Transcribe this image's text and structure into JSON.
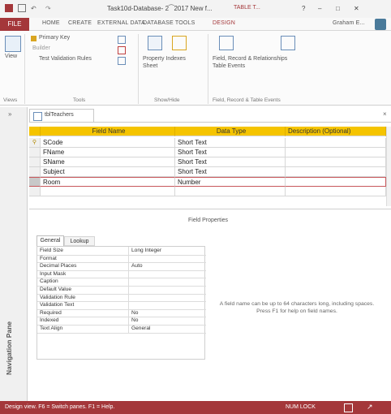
{
  "window": {
    "title": "Task10d‐Database‐ 2⁀2017 New f...",
    "context_tab": "TABLE T...",
    "help": "?",
    "user": "Graham E..."
  },
  "ribbon_tabs": [
    "FILE",
    "HOME",
    "CREATE",
    "EXTERNAL DATA",
    "DATABASE TOOLS",
    "DESIGN"
  ],
  "ribbon": {
    "view_label": "View",
    "primary_key": "Primary Key",
    "builder": "Builder",
    "test_validation": "Test Validation Rules",
    "property_sheet": "Property Indexes\nSheet",
    "field_record_events": "Field, Record & Relationships\nTable Events",
    "groups": [
      "Views",
      "Tools",
      "Show/Hide",
      "Field, Record & Table Events",
      "Relationships"
    ]
  },
  "document_tab": "tblTeachers",
  "field_grid": {
    "headers": [
      "Field Name",
      "Data Type",
      "Description (Optional)"
    ],
    "rows": [
      {
        "name": "SCode",
        "type": "Short Text",
        "key": true
      },
      {
        "name": "FName",
        "type": "Short Text",
        "key": false
      },
      {
        "name": "SName",
        "type": "Short Text",
        "key": false
      },
      {
        "name": "Subject",
        "type": "Short Text",
        "key": false
      },
      {
        "name": "Room",
        "type": "Number",
        "key": false,
        "selected": true
      }
    ]
  },
  "field_properties_label": "Field Properties",
  "property_tabs": [
    "General",
    "Lookup"
  ],
  "properties": [
    {
      "k": "Field Size",
      "v": "Long Integer"
    },
    {
      "k": "Format",
      "v": ""
    },
    {
      "k": "Decimal Places",
      "v": "Auto"
    },
    {
      "k": "Input Mask",
      "v": ""
    },
    {
      "k": "Caption",
      "v": ""
    },
    {
      "k": "Default Value",
      "v": ""
    },
    {
      "k": "Validation Rule",
      "v": ""
    },
    {
      "k": "Validation Text",
      "v": ""
    },
    {
      "k": "Required",
      "v": "No"
    },
    {
      "k": "Indexed",
      "v": "No"
    },
    {
      "k": "Text Align",
      "v": "General"
    }
  ],
  "help_text": "A field name can be up to 64 characters long, including spaces. Press F1 for help on field names.",
  "nav_pane_label": "Navigation Pane",
  "status": {
    "left": "Design view. F6 = Switch panes. F1 = Help.",
    "right": "NUM LOCK"
  },
  "colors": {
    "brand": "#a4373a",
    "header": "#f5c400"
  }
}
